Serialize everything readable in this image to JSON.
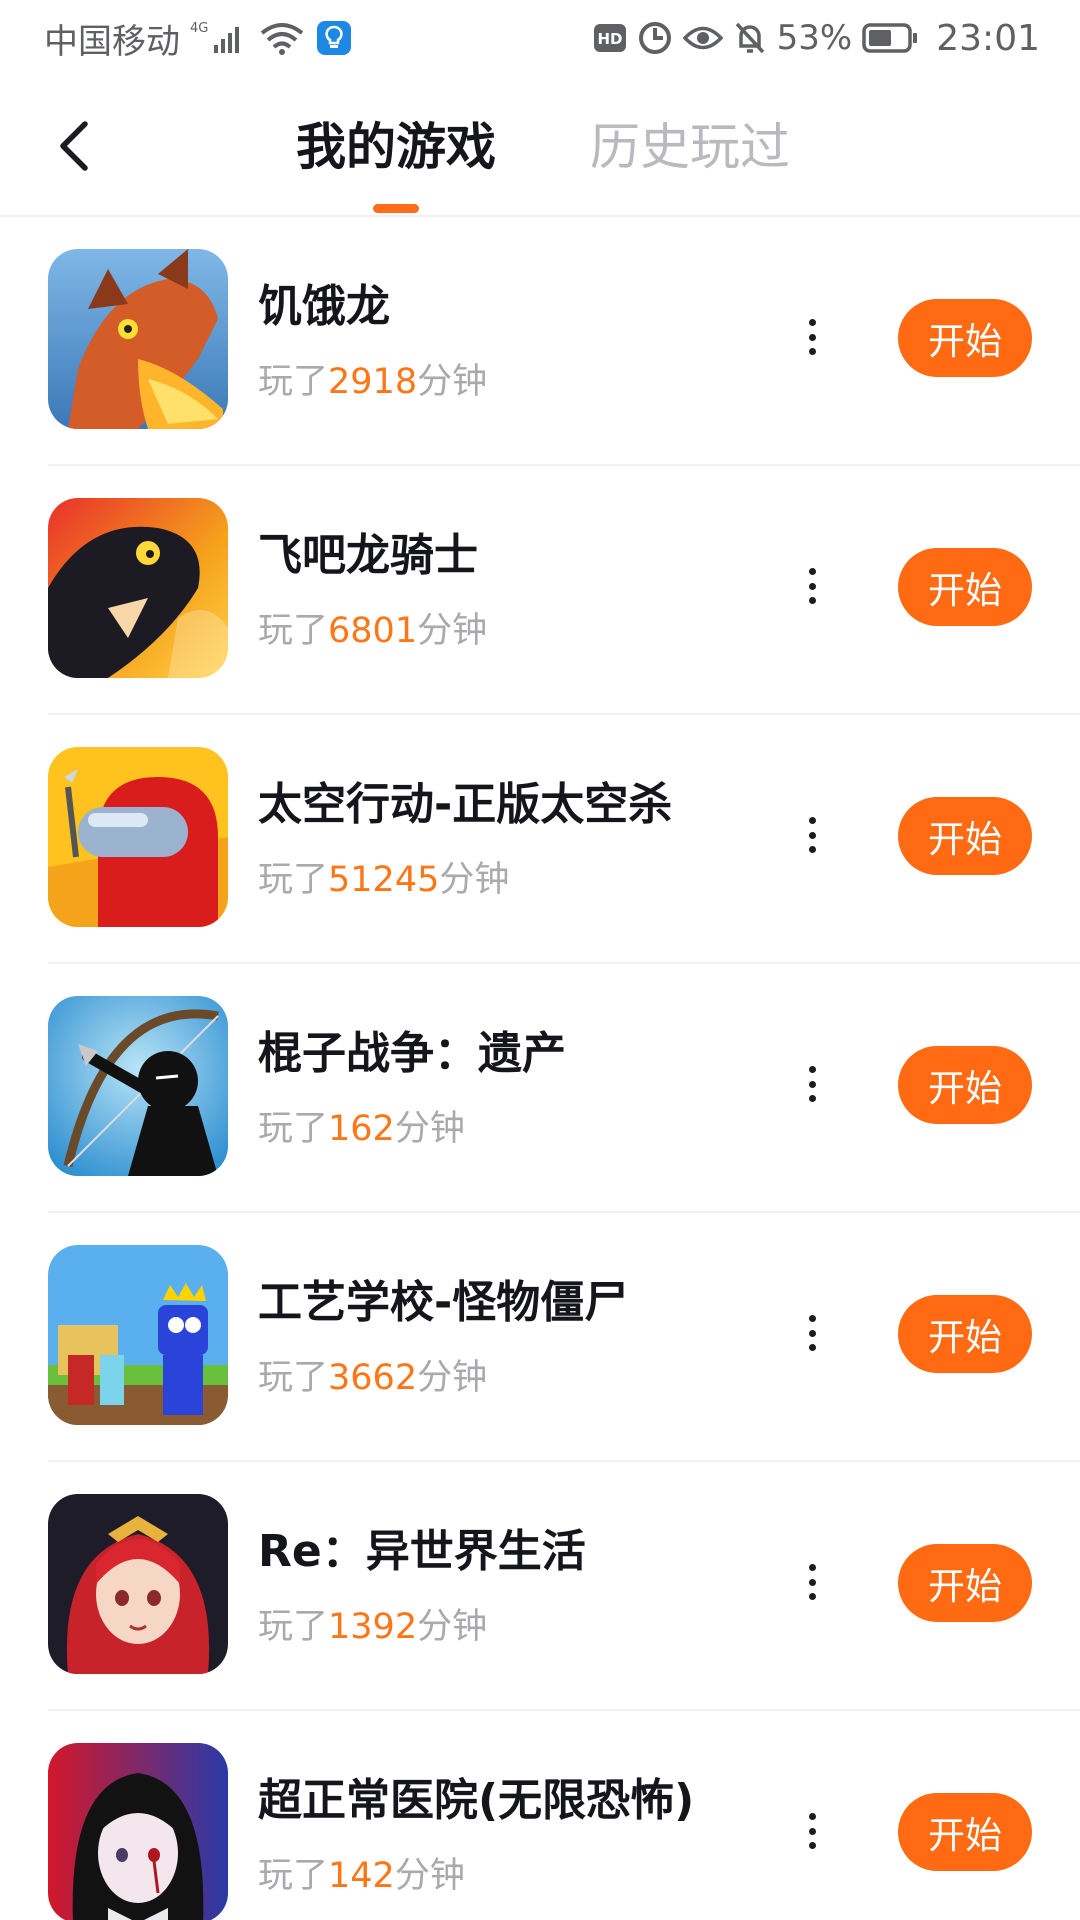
{
  "status_bar": {
    "carrier": "中国移动",
    "network": "4G",
    "battery": "53%",
    "time": "23:01",
    "hd_badge": "HD",
    "icons": [
      "signal-icon",
      "wifi-icon",
      "lightbulb-icon",
      "hd-icon",
      "data-saver-icon",
      "eye-icon",
      "bell-off-icon",
      "battery-icon"
    ]
  },
  "header": {
    "tabs": [
      {
        "label": "我的游戏",
        "active": true
      },
      {
        "label": "历史玩过",
        "active": false
      }
    ],
    "accent_color": "#ff6a13"
  },
  "games": [
    {
      "title": "饥饿龙",
      "played_prefix": "玩了",
      "minutes": "2918",
      "played_suffix": "分钟",
      "start_label": "开始"
    },
    {
      "title": "飞吧龙骑士",
      "played_prefix": "玩了",
      "minutes": "6801",
      "played_suffix": "分钟",
      "start_label": "开始"
    },
    {
      "title": "太空行动-正版太空杀",
      "played_prefix": "玩了",
      "minutes": "51245",
      "played_suffix": "分钟",
      "start_label": "开始"
    },
    {
      "title": "棍子战争：遗产",
      "played_prefix": "玩了",
      "minutes": "162",
      "played_suffix": "分钟",
      "start_label": "开始"
    },
    {
      "title": "工艺学校-怪物僵尸",
      "played_prefix": "玩了",
      "minutes": "3662",
      "played_suffix": "分钟",
      "start_label": "开始"
    },
    {
      "title": "Re：异世界生活",
      "played_prefix": "玩了",
      "minutes": "1392",
      "played_suffix": "分钟",
      "start_label": "开始"
    },
    {
      "title": "超正常医院(无限恐怖)",
      "played_prefix": "玩了",
      "minutes": "142",
      "played_suffix": "分钟",
      "start_label": "开始"
    }
  ]
}
